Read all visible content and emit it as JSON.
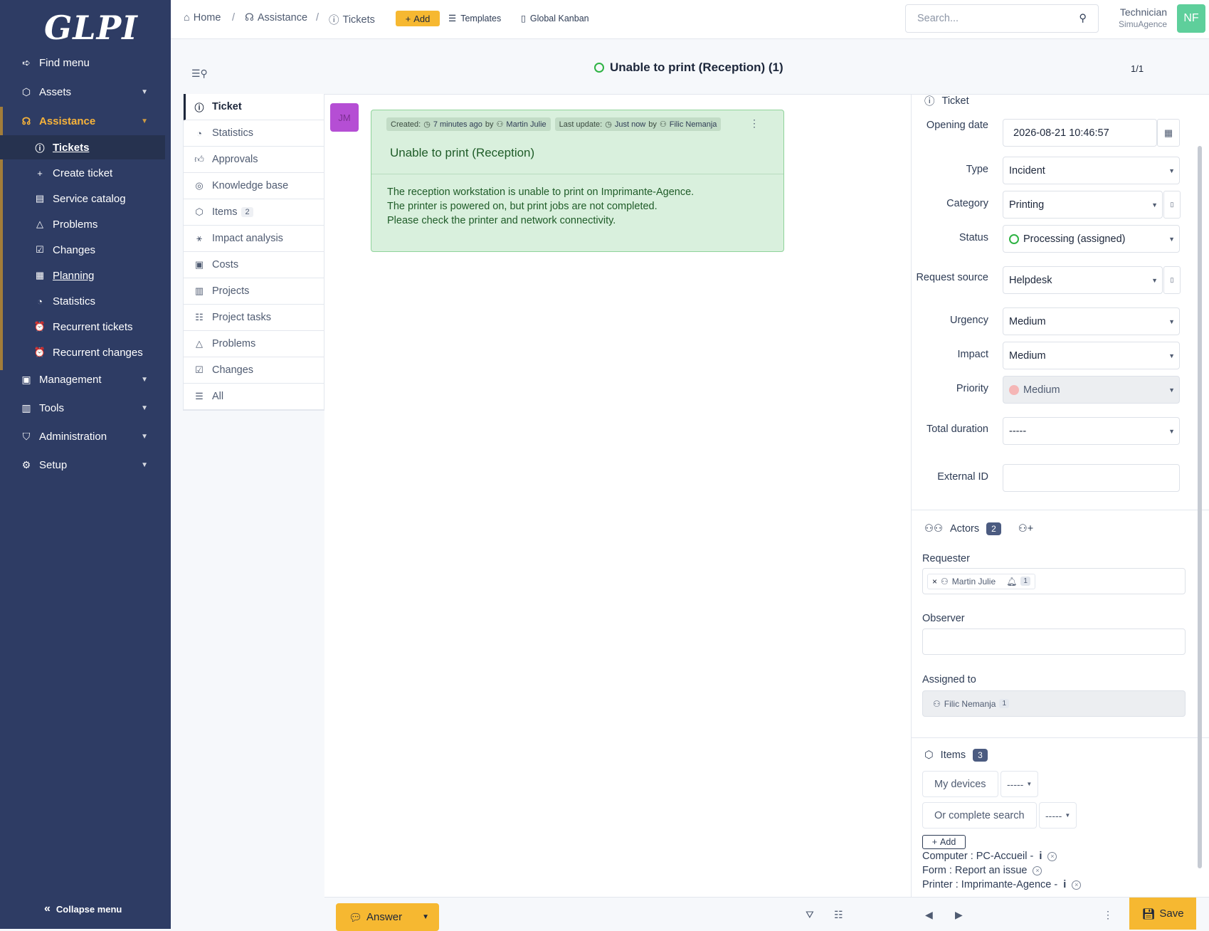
{
  "app": {
    "logo": "GLPI"
  },
  "sidebar": {
    "find_menu": "Find menu",
    "assets": "Assets",
    "assistance": "Assistance",
    "sub": [
      "Tickets",
      "Create ticket",
      "Service catalog",
      "Problems",
      "Changes",
      "Planning",
      "Statistics",
      "Recurrent tickets",
      "Recurrent changes"
    ],
    "management": "Management",
    "tools": "Tools",
    "administration": "Administration",
    "setup": "Setup",
    "collapse": "Collapse menu"
  },
  "topbar": {
    "breadcrumb": [
      "Home",
      "Assistance",
      "Tickets"
    ],
    "add": "Add",
    "templates": "Templates",
    "kanban": "Global Kanban",
    "search_placeholder": "Search...",
    "user_role": "Technician",
    "user_entity": "SimuAgence",
    "user_initials": "NF"
  },
  "ticket": {
    "title": "Unable to print (Reception) (1)",
    "pager": "1/1"
  },
  "tabs": [
    {
      "label": "Ticket"
    },
    {
      "label": "Statistics"
    },
    {
      "label": "Approvals"
    },
    {
      "label": "Knowledge base"
    },
    {
      "label": "Items",
      "badge": "2"
    },
    {
      "label": "Impact analysis"
    },
    {
      "label": "Costs"
    },
    {
      "label": "Projects"
    },
    {
      "label": "Project tasks"
    },
    {
      "label": "Problems"
    },
    {
      "label": "Changes"
    },
    {
      "label": "All"
    }
  ],
  "timeline": {
    "avatar": "JM",
    "created_label": "Created:",
    "created_when": "7 minutes ago",
    "by": "by",
    "created_by": "Martin Julie",
    "updated_label": "Last update:",
    "updated_when": "Just now",
    "updated_by": "Filic Nemanja",
    "title": "Unable to print (Reception)",
    "lines": [
      "The reception workstation is unable to print on Imprimante-Agence.",
      "The printer is powered on, but print jobs are not completed.",
      "Please check the printer and network connectivity."
    ],
    "answer": "Answer"
  },
  "form": {
    "section": "Ticket",
    "opening_date_label": "Opening date",
    "opening_date": "2026-08-21 10:46:57",
    "type_label": "Type",
    "type": "Incident",
    "category_label": "Category",
    "category": "Printing",
    "status_label": "Status",
    "status": "Processing (assigned)",
    "source_label": "Request source",
    "source": "Helpdesk",
    "urgency_label": "Urgency",
    "urgency": "Medium",
    "impact_label": "Impact",
    "impact": "Medium",
    "priority_label": "Priority",
    "priority": "Medium",
    "duration_label": "Total duration",
    "duration": "-----",
    "external_label": "External ID",
    "external": ""
  },
  "actors": {
    "title": "Actors",
    "count": "2",
    "requester_label": "Requester",
    "requester": "Martin Julie",
    "requester_count": "1",
    "observer_label": "Observer",
    "assigned_label": "Assigned to",
    "assigned": "Filic Nemanja",
    "assigned_count": "1"
  },
  "items": {
    "title": "Items",
    "count": "3",
    "my_devices": "My devices",
    "my_devices_sel": "-----",
    "complete_search": "Or complete search",
    "complete_sel": "-----",
    "add": "Add",
    "list": [
      "Computer : PC-Accueil -",
      "Form : Report an issue",
      "Printer : Imprimante-Agence -"
    ]
  },
  "footer": {
    "save": "Save"
  },
  "colors": {
    "sidebar": "#2e3c64",
    "accent": "#f6b831",
    "status_green": "#2fb344"
  }
}
